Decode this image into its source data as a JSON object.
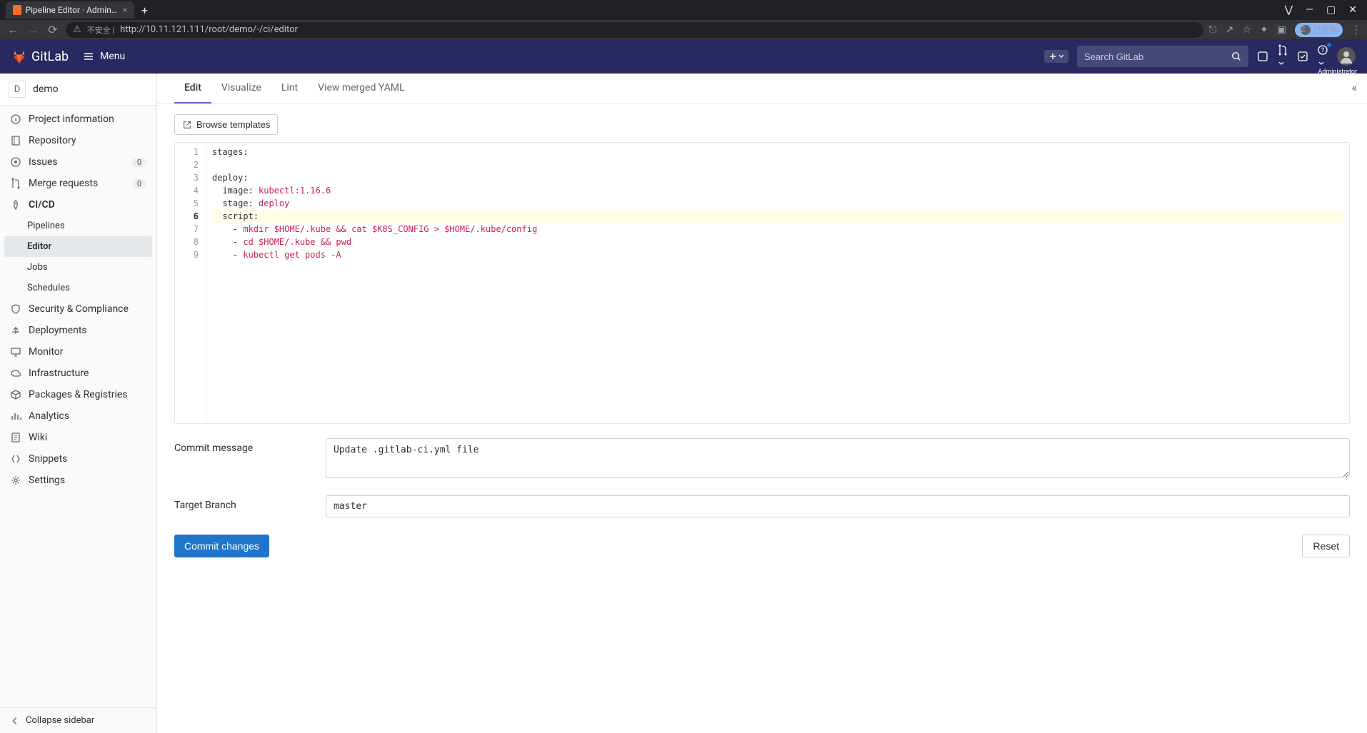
{
  "browser": {
    "tab_title": "Pipeline Editor · Administrator",
    "url_insecure_label": "不安全 |",
    "url": "http://10.11.121.111/root/demo/-/ci/editor",
    "user_chip": "已暂停"
  },
  "header": {
    "product": "GitLab",
    "menu": "Menu",
    "search_placeholder": "Search GitLab",
    "avatar_label": "Administrator"
  },
  "sidebar": {
    "project_initial": "D",
    "project_name": "demo",
    "items": [
      {
        "icon": "info",
        "label": "Project information"
      },
      {
        "icon": "repo",
        "label": "Repository"
      },
      {
        "icon": "issues",
        "label": "Issues",
        "badge": "0"
      },
      {
        "icon": "merge",
        "label": "Merge requests",
        "badge": "0"
      },
      {
        "icon": "rocket",
        "label": "CI/CD",
        "active_parent": true
      },
      {
        "sub": true,
        "label": "Pipelines"
      },
      {
        "sub": true,
        "label": "Editor",
        "active": true
      },
      {
        "sub": true,
        "label": "Jobs"
      },
      {
        "sub": true,
        "label": "Schedules"
      },
      {
        "icon": "shield",
        "label": "Security & Compliance"
      },
      {
        "icon": "deploy",
        "label": "Deployments"
      },
      {
        "icon": "monitor",
        "label": "Monitor"
      },
      {
        "icon": "cloud",
        "label": "Infrastructure"
      },
      {
        "icon": "package",
        "label": "Packages & Registries"
      },
      {
        "icon": "analytics",
        "label": "Analytics"
      },
      {
        "icon": "wiki",
        "label": "Wiki"
      },
      {
        "icon": "snippets",
        "label": "Snippets"
      },
      {
        "icon": "settings",
        "label": "Settings"
      }
    ],
    "collapse": "Collapse sidebar"
  },
  "tabs": [
    "Edit",
    "Visualize",
    "Lint",
    "View merged YAML"
  ],
  "browse_templates": "Browse templates",
  "editor": {
    "lines": [
      {
        "n": 1,
        "tokens": [
          {
            "t": "key",
            "v": "stages"
          },
          {
            "t": "plain",
            "v": ":"
          }
        ]
      },
      {
        "n": 2,
        "tokens": []
      },
      {
        "n": 3,
        "tokens": [
          {
            "t": "key",
            "v": "deploy"
          },
          {
            "t": "plain",
            "v": ":"
          }
        ]
      },
      {
        "n": 4,
        "indent": 1,
        "tokens": [
          {
            "t": "key",
            "v": "image"
          },
          {
            "t": "plain",
            "v": ": "
          },
          {
            "t": "val",
            "v": "kubectl:1.16.6"
          }
        ]
      },
      {
        "n": 5,
        "indent": 1,
        "tokens": [
          {
            "t": "key",
            "v": "stage"
          },
          {
            "t": "plain",
            "v": ": "
          },
          {
            "t": "val",
            "v": "deploy"
          }
        ]
      },
      {
        "n": 6,
        "current": true,
        "indent": 1,
        "tokens": [
          {
            "t": "key",
            "v": "script"
          },
          {
            "t": "plain",
            "v": ":"
          }
        ]
      },
      {
        "n": 7,
        "indent": 2,
        "tokens": [
          {
            "t": "dash",
            "v": "- "
          },
          {
            "t": "val",
            "v": "mkdir $HOME/.kube && cat $K8S_CONFIG > $HOME/.kube/config"
          }
        ]
      },
      {
        "n": 8,
        "indent": 2,
        "tokens": [
          {
            "t": "dash",
            "v": "- "
          },
          {
            "t": "val",
            "v": "cd $HOME/.kube && pwd"
          }
        ]
      },
      {
        "n": 9,
        "indent": 2,
        "tokens": [
          {
            "t": "dash",
            "v": "- "
          },
          {
            "t": "val",
            "v": "kubectl get pods -A"
          }
        ]
      }
    ]
  },
  "form": {
    "commit_message_label": "Commit message",
    "commit_message": "Update .gitlab-ci.yml file",
    "target_branch_label": "Target Branch",
    "target_branch": "master",
    "commit_btn": "Commit changes",
    "reset_btn": "Reset"
  }
}
